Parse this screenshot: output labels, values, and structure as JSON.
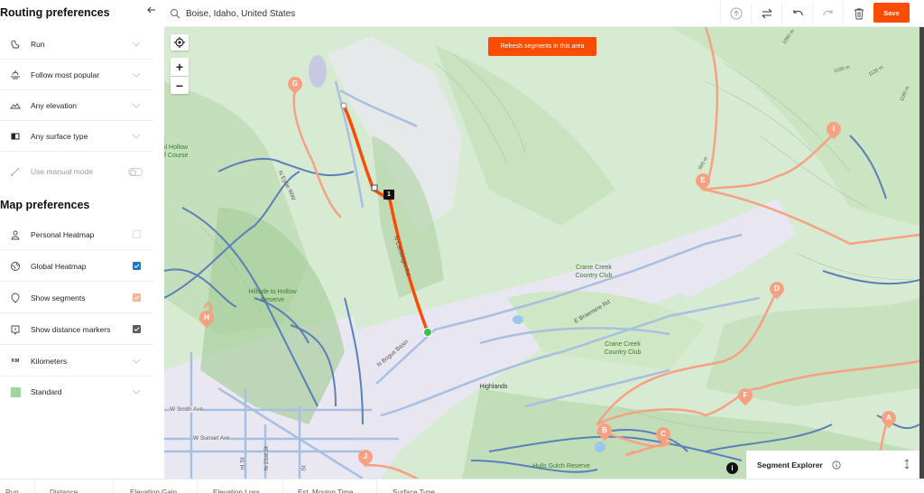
{
  "sidebar": {
    "routing_title": "Routing preferences",
    "collapse_icon": "arrow-left-icon",
    "routing_items": [
      {
        "label": "Run",
        "icon": "shoe-icon",
        "control": "dropdown"
      },
      {
        "label": "Follow most popular",
        "icon": "popularity-icon",
        "control": "dropdown"
      },
      {
        "label": "Any elevation",
        "icon": "elevation-icon",
        "control": "dropdown"
      },
      {
        "label": "Any surface type",
        "icon": "surface-icon",
        "control": "dropdown"
      },
      {
        "label": "Use manual mode",
        "icon": "pen-icon",
        "control": "toggle",
        "enabled": false
      }
    ],
    "map_title": "Map preferences",
    "map_items": [
      {
        "label": "Personal Heatmap",
        "icon": "person-icon",
        "control": "checkbox",
        "checked": false
      },
      {
        "label": "Global Heatmap",
        "icon": "globe-icon",
        "control": "checkbox",
        "checked": true,
        "color": "#1d77c6"
      },
      {
        "label": "Show segments",
        "icon": "segment-icon",
        "control": "checkbox",
        "checked": true,
        "color": "#f9b294"
      },
      {
        "label": "Show distance markers",
        "icon": "marker-icon",
        "control": "checkbox",
        "checked": true,
        "color": "#5c5c66"
      },
      {
        "label": "Kilometers",
        "icon_text": "KM",
        "control": "dropdown"
      },
      {
        "label": "Standard",
        "icon": "map-thumb-icon",
        "control": "dropdown"
      }
    ]
  },
  "topbar": {
    "search_value": "Boise, Idaho, United States",
    "buttons": [
      "upload-icon",
      "swap-icon",
      "undo-icon",
      "redo-icon",
      "trash-icon"
    ],
    "save_label": "Save"
  },
  "map": {
    "refresh_label": "Refresh segments in this area",
    "zoom_in": "+",
    "zoom_out": "−",
    "distance_marker": "1",
    "labels": {
      "golf_course": "il Hollow\nf Course",
      "hillside": "Hillside to Hollow\nReserve",
      "crane1": "Crane Creek\nCountry Club",
      "crane2": "Crane Creek\nCountry Club",
      "highlands": "Highlands",
      "hulls": "Hulls Gulch Reserve"
    },
    "roads": {
      "eyrie": "N Eyrie Way",
      "cartwright": "N Cartwright Rd",
      "bogus": "N Bogus Basin",
      "braemere": "E Braemere Rd",
      "smith": "W Smith Ave",
      "sunset": "W Sunset Ave",
      "st21": "N 21st St",
      "rd": "rd St",
      "st": "St"
    },
    "contours": [
      "1060 m",
      "1100 m",
      "1120 m",
      "1180 m",
      "960 m"
    ],
    "segment_pins": [
      "A",
      "B",
      "C",
      "D",
      "E",
      "F",
      "G",
      "H",
      "I",
      "J"
    ],
    "colors": {
      "route": "#fc4c02",
      "segment": "#f7a183",
      "trail": "#5b7fb8",
      "start": "#3fbf4f"
    }
  },
  "segment_explorer": {
    "title": "Segment Explorer",
    "info_icon": "info-circle-icon",
    "resize_icon": "expand-vertical-icon"
  },
  "bottombar": {
    "stats": [
      "Run",
      "Distance",
      "Elevation Gain",
      "Elevation Loss",
      "Est. Moving Time",
      "Surface Type"
    ]
  }
}
